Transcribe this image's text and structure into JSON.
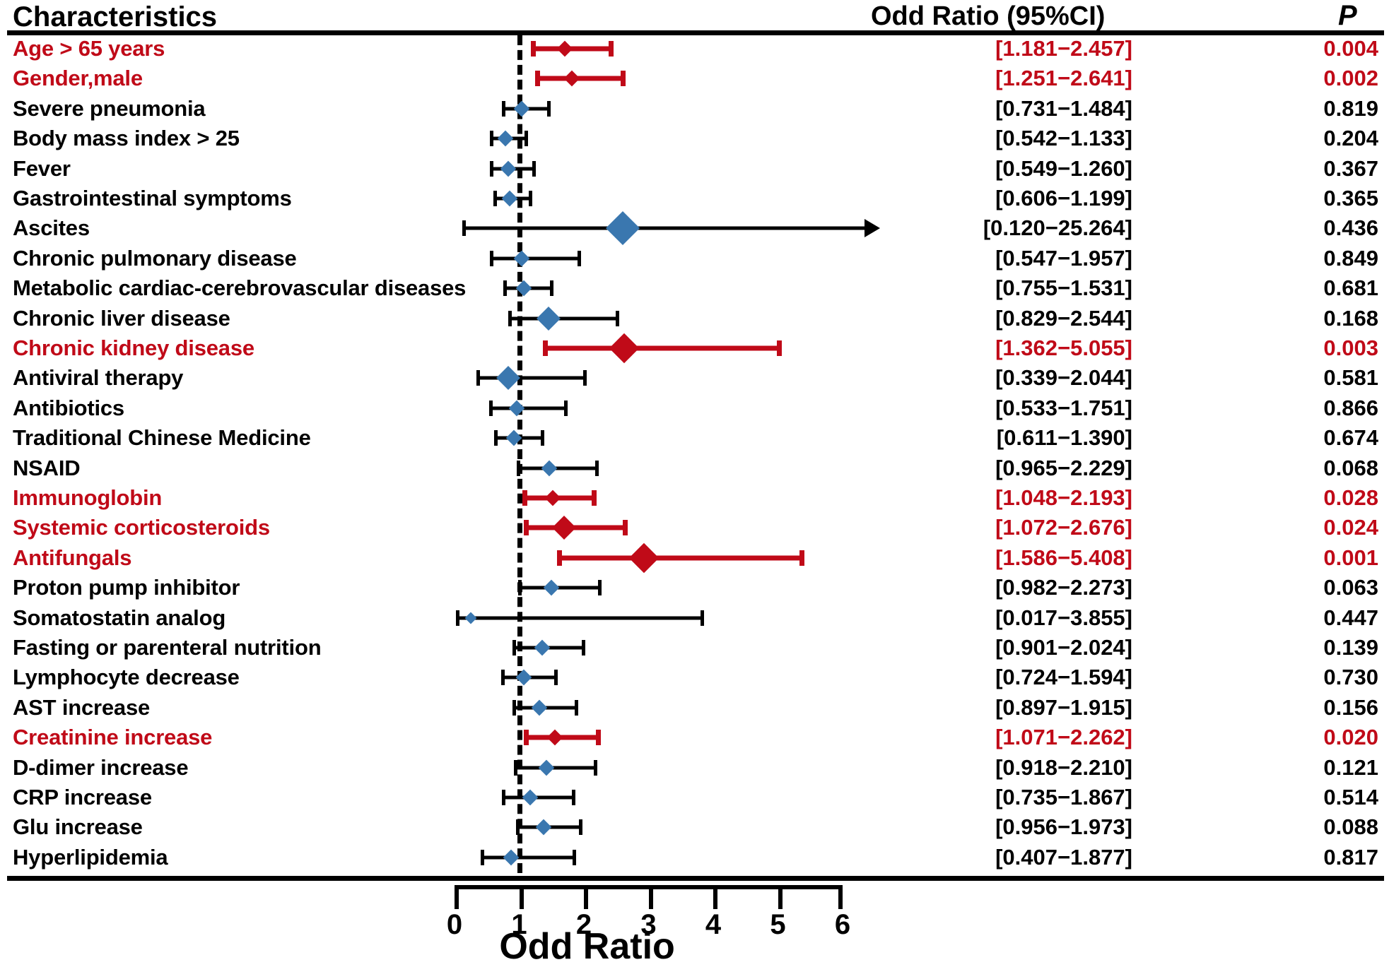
{
  "header": {
    "characteristics": "Characteristics",
    "odd_ratio": "Odd Ratio (95%CI)",
    "p": "P"
  },
  "axis": {
    "title": "Odd Ratio",
    "ticks": [
      "0",
      "1",
      "2",
      "3",
      "4",
      "5",
      "6"
    ]
  },
  "colors": {
    "significant": "#C00A18",
    "nonsignificant": "#000000",
    "marker_nonsig": "#3A77AF",
    "marker_sig": "#C00A18",
    "background": "#FFFFFF"
  },
  "chart_data": {
    "type": "scatter",
    "title": "",
    "xlabel": "Odd Ratio",
    "ylabel": "Characteristics",
    "xlim": [
      0,
      6
    ],
    "xticks": [
      0,
      1,
      2,
      3,
      4,
      5,
      6
    ],
    "reference_line": 1,
    "grid": false,
    "legend": "none",
    "columns": [
      "Characteristics",
      "Odd Ratio (95%CI)",
      "P"
    ],
    "rows": [
      {
        "label": "Age > 65 years",
        "or": 1.704,
        "low": 1.181,
        "high": 2.457,
        "ci": "[1.181−2.457]",
        "p": "0.004",
        "significant": true,
        "truncated": false
      },
      {
        "label": "Gender,male",
        "or": 1.817,
        "low": 1.251,
        "high": 2.641,
        "ci": "[1.251−2.641]",
        "p": "0.002",
        "significant": true,
        "truncated": false
      },
      {
        "label": "Severe pneumonia",
        "or": 1.042,
        "low": 0.731,
        "high": 1.484,
        "ci": "[0.731−1.484]",
        "p": "0.819",
        "significant": false,
        "truncated": false
      },
      {
        "label": "Body mass index > 25",
        "or": 0.784,
        "low": 0.542,
        "high": 1.133,
        "ci": "[0.542−1.133]",
        "p": "0.204",
        "significant": false,
        "truncated": false
      },
      {
        "label": "Fever",
        "or": 0.832,
        "low": 0.549,
        "high": 1.26,
        "ci": "[0.549−1.260]",
        "p": "0.367",
        "significant": false,
        "truncated": false
      },
      {
        "label": "Gastrointestinal symptoms",
        "or": 0.853,
        "low": 0.606,
        "high": 1.199,
        "ci": "[0.606−1.199]",
        "p": "0.365",
        "significant": false,
        "truncated": false
      },
      {
        "label": "Ascites",
        "or": 2.6,
        "low": 0.12,
        "high": 25.264,
        "ci": "[0.120−25.264]",
        "p": "0.436",
        "significant": false,
        "truncated": true
      },
      {
        "label": "Chronic pulmonary disease",
        "or": 1.035,
        "low": 0.547,
        "high": 1.957,
        "ci": "[0.547−1.957]",
        "p": "0.849",
        "significant": false,
        "truncated": false
      },
      {
        "label": "Metabolic cardiac-cerebrovascular diseases",
        "or": 1.075,
        "low": 0.755,
        "high": 1.531,
        "ci": "[0.755−1.531]",
        "p": "0.681",
        "significant": false,
        "truncated": false
      },
      {
        "label": "Chronic liver disease",
        "or": 1.452,
        "low": 0.829,
        "high": 2.544,
        "ci": "[0.829−2.544]",
        "p": "0.168",
        "significant": false,
        "truncated": false
      },
      {
        "label": "Chronic kidney disease",
        "or": 2.624,
        "low": 1.362,
        "high": 5.055,
        "ci": "[1.362−5.055]",
        "p": "0.003",
        "significant": true,
        "truncated": false
      },
      {
        "label": "Antiviral therapy",
        "or": 0.832,
        "low": 0.339,
        "high": 2.044,
        "ci": "[0.339−2.044]",
        "p": "0.581",
        "significant": false,
        "truncated": false
      },
      {
        "label": "Antibiotics",
        "or": 0.966,
        "low": 0.533,
        "high": 1.751,
        "ci": "[0.533−1.751]",
        "p": "0.866",
        "significant": false,
        "truncated": false
      },
      {
        "label": "Traditional Chinese Medicine",
        "or": 0.921,
        "low": 0.611,
        "high": 1.39,
        "ci": "[0.611−1.390]",
        "p": "0.674",
        "significant": false,
        "truncated": false
      },
      {
        "label": "NSAID",
        "or": 1.467,
        "low": 0.965,
        "high": 2.229,
        "ci": "[0.965−2.229]",
        "p": "0.068",
        "significant": false,
        "truncated": false
      },
      {
        "label": "Immunoglobin",
        "or": 1.516,
        "low": 1.048,
        "high": 2.193,
        "ci": "[1.048−2.193]",
        "p": "0.028",
        "significant": true,
        "truncated": false
      },
      {
        "label": "Systemic corticosteroids",
        "or": 1.694,
        "low": 1.072,
        "high": 2.676,
        "ci": "[1.072−2.676]",
        "p": "0.024",
        "significant": true,
        "truncated": false
      },
      {
        "label": "Antifungals",
        "or": 2.929,
        "low": 1.586,
        "high": 5.408,
        "ci": "[1.586−5.408]",
        "p": "0.001",
        "significant": true,
        "truncated": false
      },
      {
        "label": "Proton pump inhibitor",
        "or": 1.494,
        "low": 0.982,
        "high": 2.273,
        "ci": "[0.982−2.273]",
        "p": "0.063",
        "significant": false,
        "truncated": false
      },
      {
        "label": "Somatostatin analog",
        "or": 0.256,
        "low": 0.017,
        "high": 3.855,
        "ci": "[0.017−3.855]",
        "p": "0.447",
        "significant": false,
        "truncated": false
      },
      {
        "label": "Fasting or  parenteral nutrition",
        "or": 1.35,
        "low": 0.901,
        "high": 2.024,
        "ci": "[0.901−2.024]",
        "p": "0.139",
        "significant": false,
        "truncated": false
      },
      {
        "label": "Lymphocyte decrease",
        "or": 1.074,
        "low": 0.724,
        "high": 1.594,
        "ci": "[0.724−1.594]",
        "p": "0.730",
        "significant": false,
        "truncated": false
      },
      {
        "label": "AST increase",
        "or": 1.311,
        "low": 0.897,
        "high": 1.915,
        "ci": "[0.897−1.915]",
        "p": "0.156",
        "significant": false,
        "truncated": false
      },
      {
        "label": "Creatinine increase",
        "or": 1.557,
        "low": 1.071,
        "high": 2.262,
        "ci": "[1.071−2.262]",
        "p": "0.020",
        "significant": true,
        "truncated": false
      },
      {
        "label": "D-dimer increase",
        "or": 1.424,
        "low": 0.918,
        "high": 2.21,
        "ci": "[0.918−2.210]",
        "p": "0.121",
        "significant": false,
        "truncated": false
      },
      {
        "label": "CRP increase",
        "or": 1.171,
        "low": 0.735,
        "high": 1.867,
        "ci": "[0.735−1.867]",
        "p": "0.514",
        "significant": false,
        "truncated": false
      },
      {
        "label": "Glu increase",
        "or": 1.373,
        "low": 0.956,
        "high": 1.973,
        "ci": "[0.956−1.973]",
        "p": "0.088",
        "significant": false,
        "truncated": false
      },
      {
        "label": "Hyperlipidemia",
        "or": 0.874,
        "low": 0.407,
        "high": 1.877,
        "ci": "[0.407−1.877]",
        "p": "0.817",
        "significant": false,
        "truncated": false
      }
    ]
  }
}
